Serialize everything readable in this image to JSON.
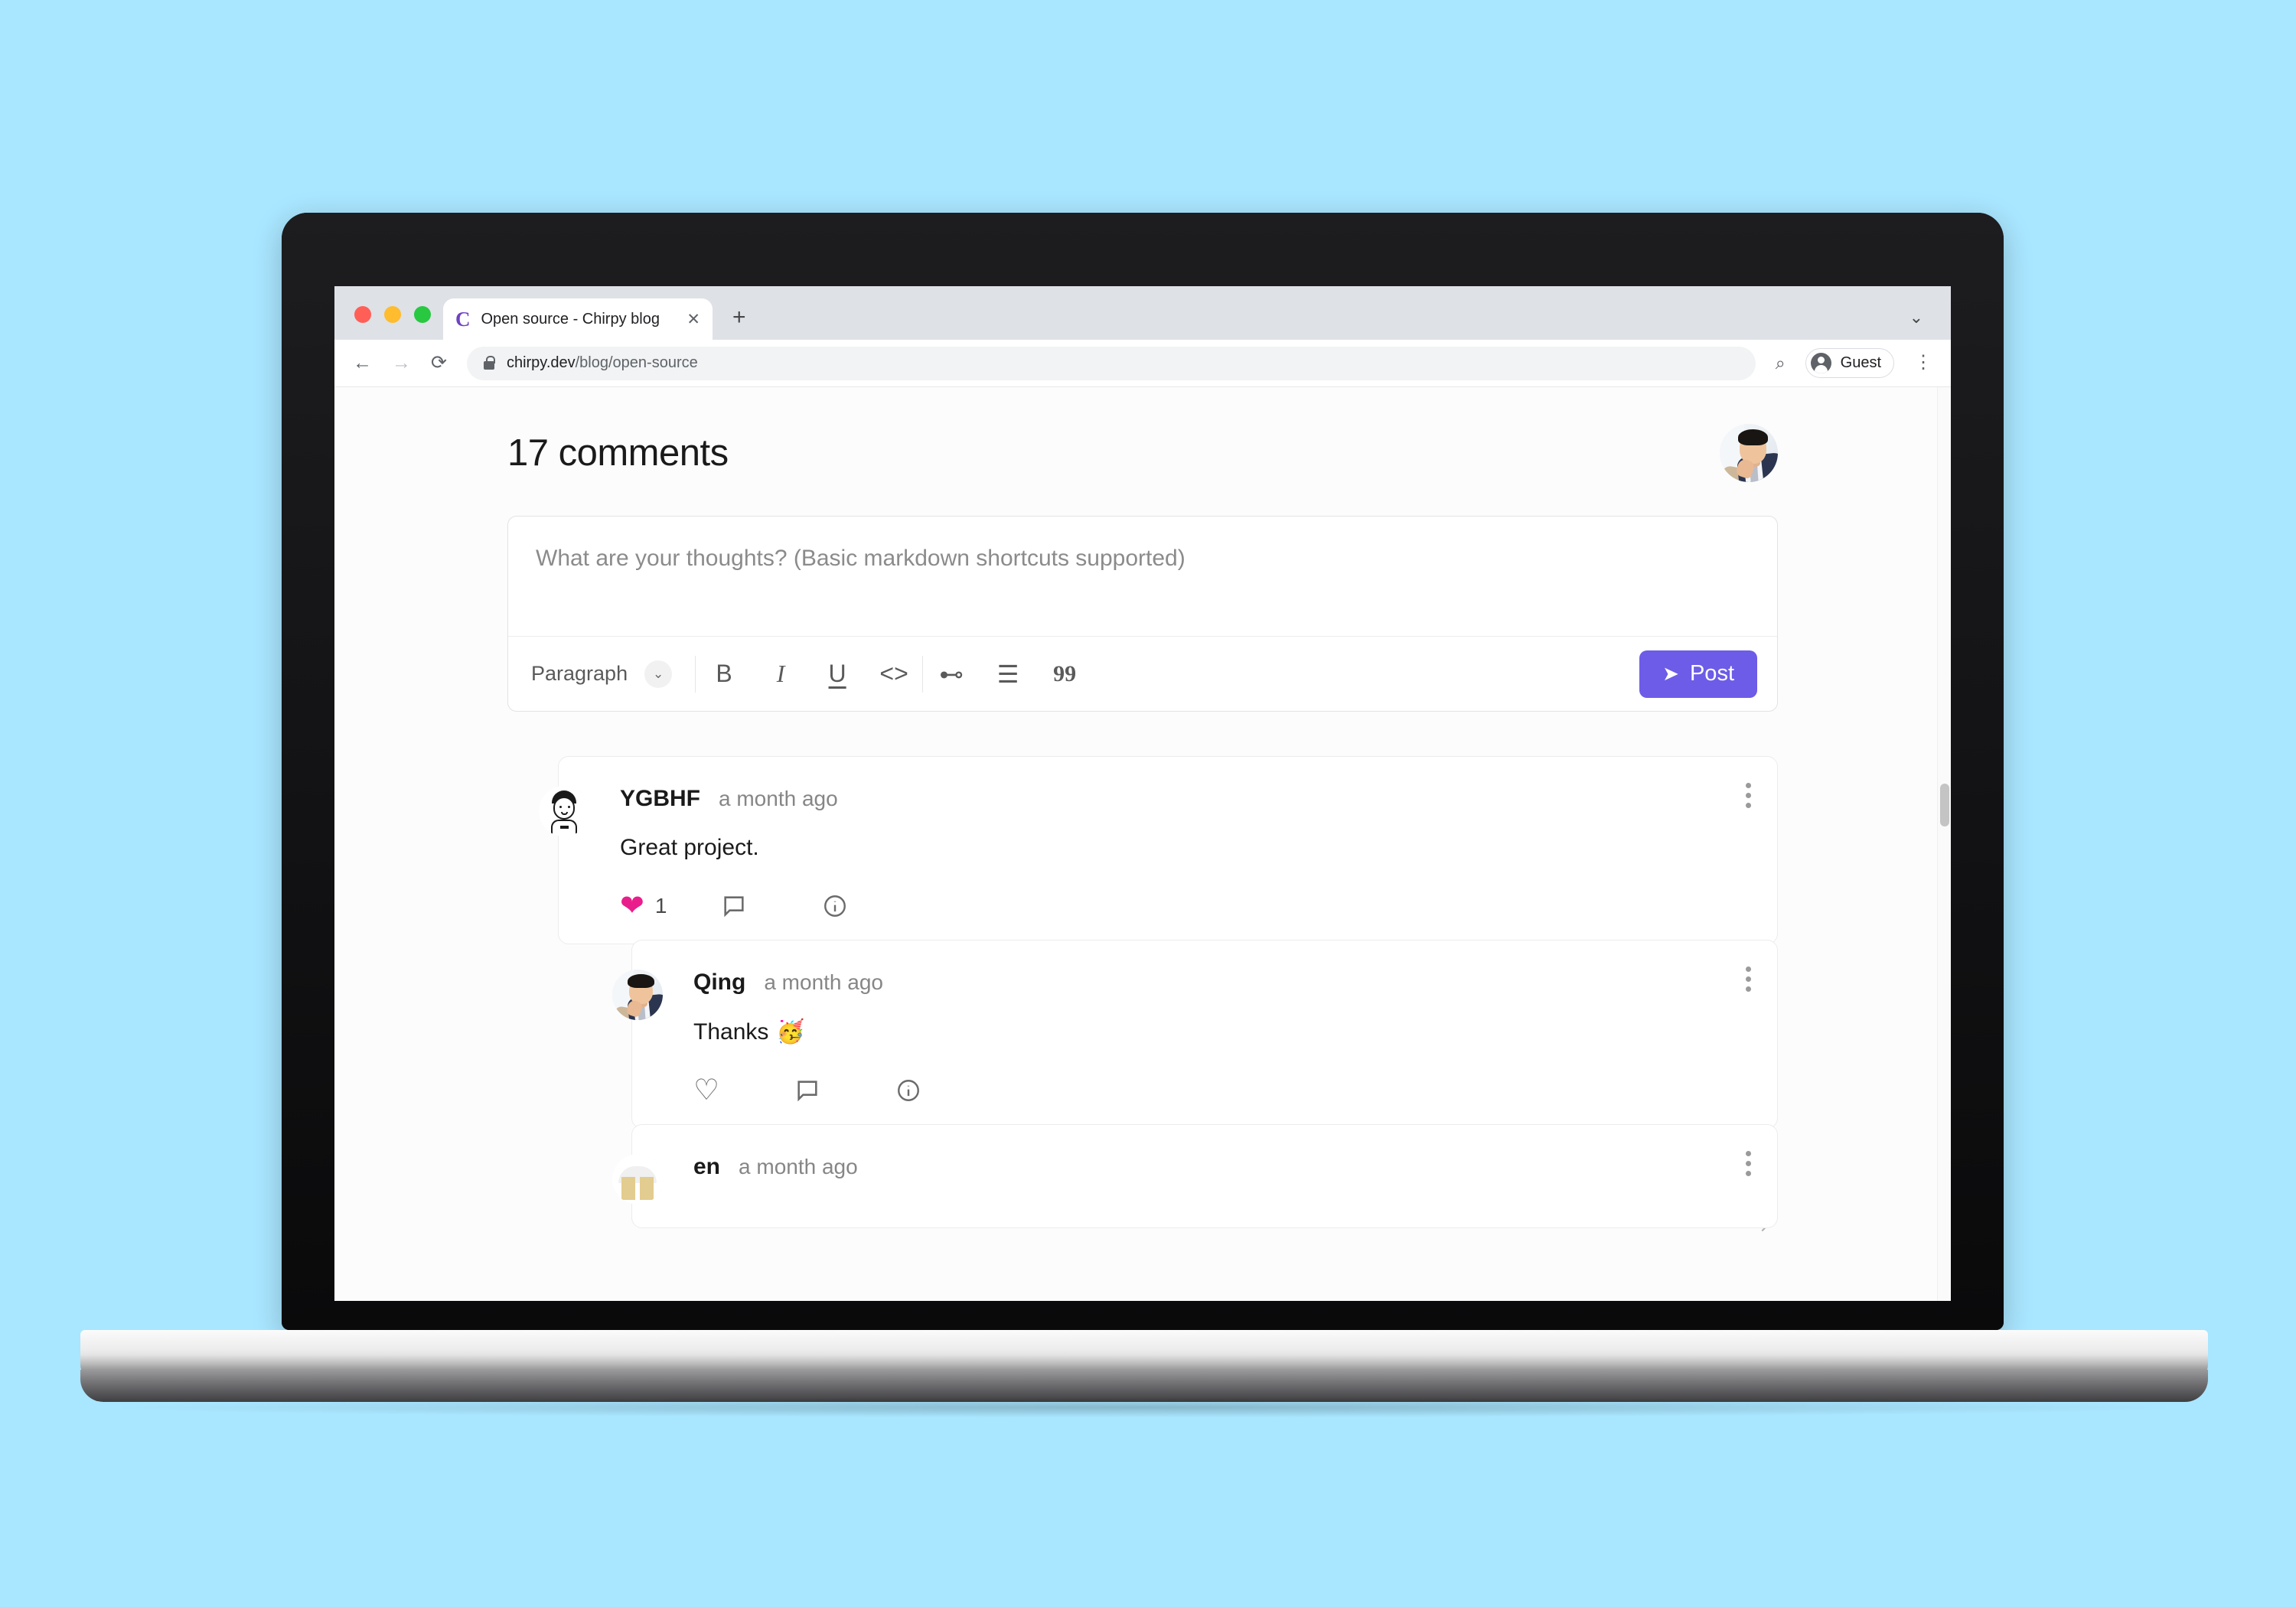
{
  "browser": {
    "traffic_lights": [
      "close",
      "minimize",
      "maximize"
    ],
    "tab": {
      "favicon_letter": "C",
      "title": "Open source - Chirpy blog",
      "close_label": "✕"
    },
    "new_tab_label": "+",
    "tab_list_chevron": "⌄",
    "nav": {
      "back": "←",
      "forward": "→",
      "reload": "⟳"
    },
    "url": {
      "domain": "chirpy.dev",
      "path": "/blog/open-source"
    },
    "zoom_icon": "⌕",
    "profile": {
      "label": "Guest"
    },
    "menu_icon": "⋮"
  },
  "page": {
    "title": "17 comments",
    "composer": {
      "placeholder": "What are your thoughts? (Basic markdown shortcuts supported)",
      "value": "",
      "style_select": "Paragraph",
      "caret": "⌄",
      "tools": [
        {
          "name": "bold",
          "glyph": "B"
        },
        {
          "name": "italic",
          "glyph": "I"
        },
        {
          "name": "underline",
          "glyph": "U"
        },
        {
          "name": "code",
          "glyph": "<>"
        },
        {
          "name": "link",
          "glyph": "⊷"
        },
        {
          "name": "bullet-list",
          "glyph": "☰"
        },
        {
          "name": "blockquote",
          "glyph": "99"
        }
      ],
      "post_label": "Post",
      "post_icon": "➤",
      "post_color": "#6c5ce7"
    },
    "comments": [
      {
        "author": "YGBHF",
        "time": "a month ago",
        "text": "Great project.",
        "emoji": "",
        "like_count": "1",
        "liked": true,
        "reply_icon": "reply",
        "info_icon": "info",
        "replies": [
          {
            "author": "Qing",
            "time": "a month ago",
            "text": "Thanks",
            "emoji": "🥳",
            "like_count": "",
            "liked": false
          }
        ]
      },
      {
        "author": "en",
        "time": "a month ago",
        "text": "",
        "emoji": "",
        "like_count": "",
        "liked": false,
        "replies": []
      }
    ],
    "accent_heart_color": "#e91e8c"
  }
}
